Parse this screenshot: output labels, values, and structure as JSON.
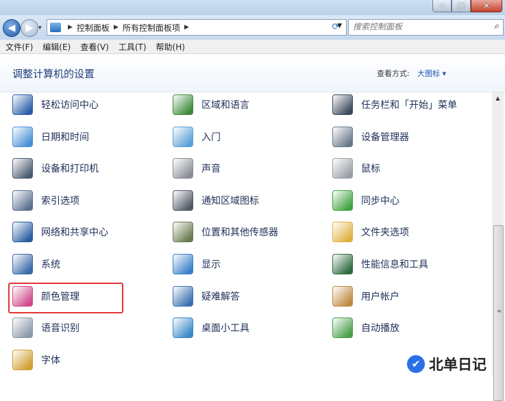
{
  "window_buttons": {
    "minimize": "─",
    "maximize": "□",
    "close": "✕"
  },
  "address": {
    "crumbs": [
      "控制面板",
      "所有控制面板项"
    ],
    "search_placeholder": "搜索控制面板"
  },
  "menu": [
    "文件(F)",
    "编辑(E)",
    "查看(V)",
    "工具(T)",
    "帮助(H)"
  ],
  "page_title": "调整计算机的设置",
  "view_by": {
    "label": "查看方式:",
    "value": "大图标 ▾"
  },
  "items": [
    {
      "label": "轻松访问中心",
      "icon": "ease-of-access-icon",
      "color": "#2b5ea8"
    },
    {
      "label": "区域和语言",
      "icon": "globe-clock-icon",
      "color": "#3d8a3a"
    },
    {
      "label": "任务栏和「开始」菜单",
      "icon": "taskbar-icon",
      "color": "#3b4a5c"
    },
    {
      "label": "日期和时间",
      "icon": "calendar-clock-icon",
      "color": "#4a8fd6"
    },
    {
      "label": "入门",
      "icon": "getting-started-icon",
      "color": "#5aa0d8"
    },
    {
      "label": "设备管理器",
      "icon": "device-manager-icon",
      "color": "#6a7a8a"
    },
    {
      "label": "设备和打印机",
      "icon": "printer-icon",
      "color": "#4a5a70"
    },
    {
      "label": "声音",
      "icon": "speaker-icon",
      "color": "#8a8f96"
    },
    {
      "label": "鼠标",
      "icon": "mouse-icon",
      "color": "#9aa0a6"
    },
    {
      "label": "索引选项",
      "icon": "magnifier-icon",
      "color": "#5a7090"
    },
    {
      "label": "通知区域图标",
      "icon": "notification-area-icon",
      "color": "#505a66"
    },
    {
      "label": "同步中心",
      "icon": "sync-icon",
      "color": "#3fa33f"
    },
    {
      "label": "网络和共享中心",
      "icon": "network-icon",
      "color": "#2a5da0"
    },
    {
      "label": "位置和其他传感器",
      "icon": "sensor-icon",
      "color": "#6a7a50"
    },
    {
      "label": "文件夹选项",
      "icon": "folder-options-icon",
      "color": "#e0b040"
    },
    {
      "label": "系统",
      "icon": "system-icon",
      "color": "#3a6aa8"
    },
    {
      "label": "显示",
      "icon": "display-icon",
      "color": "#3a80c8"
    },
    {
      "label": "性能信息和工具",
      "icon": "performance-icon",
      "color": "#2f6a3f"
    },
    {
      "label": "颜色管理",
      "icon": "color-management-icon",
      "color": "#d04a8a"
    },
    {
      "label": "疑难解答",
      "icon": "troubleshooting-icon",
      "color": "#3a70b0"
    },
    {
      "label": "用户帐户",
      "icon": "user-accounts-icon",
      "color": "#c08a40"
    },
    {
      "label": "语音识别",
      "icon": "microphone-icon",
      "color": "#8a9aa8"
    },
    {
      "label": "桌面小工具",
      "icon": "gadgets-icon",
      "color": "#3a88c8"
    },
    {
      "label": "自动播放",
      "icon": "autoplay-icon",
      "color": "#4aa04a"
    },
    {
      "label": "字体",
      "icon": "fonts-icon",
      "color": "#d0a030"
    }
  ],
  "watermark": {
    "logo": "✔",
    "text": "北单日记"
  }
}
